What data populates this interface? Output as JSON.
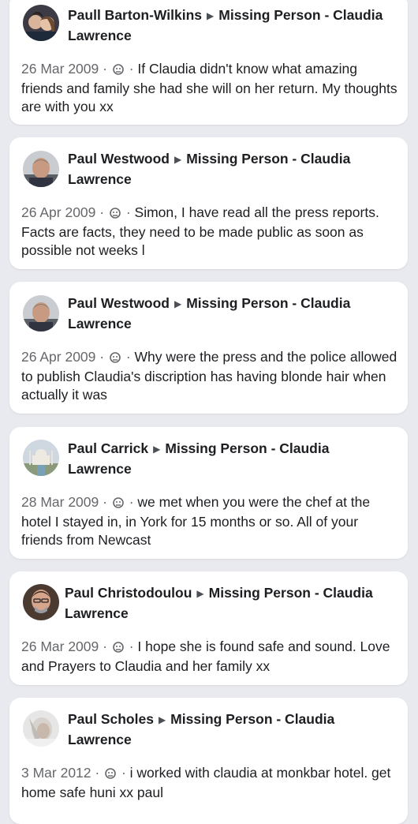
{
  "colors": {
    "background": "#e9eaef",
    "card": "#ffffff",
    "meta": "#65676b"
  },
  "posts": [
    {
      "author": "Paull Barton-Wilkins",
      "target": "Missing Person - Claudia Lawrence",
      "date": "26 Mar 2009",
      "text": "If Claudia didn't know what amazing friends and family she had she will on her return. My thoughts are with you xx"
    },
    {
      "author": "Paul Westwood",
      "target": "Missing Person - Claudia Lawrence",
      "date": "26 Apr 2009",
      "text": "Simon, I have read all the press reports. Facts are facts, they need to be made public as soon as possible not weeks l"
    },
    {
      "author": "Paul Westwood",
      "target": "Missing Person - Claudia Lawrence",
      "date": "26 Apr 2009",
      "text": "Why were the press and the police allowed to publish Claudia's discription has having blonde hair when actually it was"
    },
    {
      "author": "Paul Carrick",
      "target": "Missing Person - Claudia Lawrence",
      "date": "28 Mar 2009",
      "text": "we met when you were the chef at the hotel I stayed in, in York for 15 months or so.  All of your friends from Newcast"
    },
    {
      "author": "Paul Christodoulou",
      "target": "Missing Person - Claudia Lawrence",
      "date": "26 Mar 2009",
      "text": "I hope she is found safe and sound. Love and Prayers to Claudia and her family xx"
    },
    {
      "author": "Paul Scholes",
      "target": "Missing Person - Claudia Lawrence",
      "date": "3 Mar 2012",
      "text": "i worked with claudia at monkbar hotel. get home safe huni xx paul"
    }
  ]
}
